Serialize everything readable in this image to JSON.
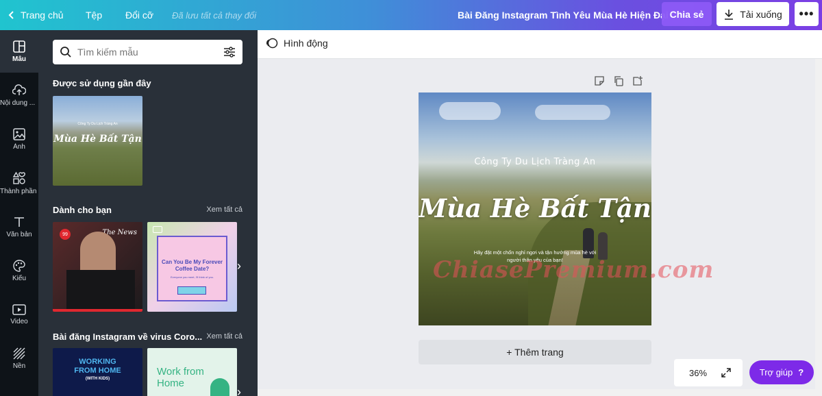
{
  "topbar": {
    "home_label": "Trang chủ",
    "file_label": "Tệp",
    "resize_label": "Đổi cỡ",
    "saved_status": "Đã lưu tất cả thay đổi",
    "doc_title": "Bài Đăng Instagram Tình Yêu Mùa Hè Hiện Đại",
    "share_label": "Chia sẻ",
    "download_label": "Tải xuống",
    "more_label": "•••"
  },
  "rail": {
    "items": [
      {
        "label": "Mẫu",
        "icon": "template-icon"
      },
      {
        "label": "Nội dung ...",
        "icon": "upload-icon"
      },
      {
        "label": "Ảnh",
        "icon": "photo-icon"
      },
      {
        "label": "Thành phần",
        "icon": "elements-icon"
      },
      {
        "label": "Văn bản",
        "icon": "text-icon"
      },
      {
        "label": "Kiểu",
        "icon": "palette-icon"
      },
      {
        "label": "Video",
        "icon": "video-icon"
      },
      {
        "label": "Nền",
        "icon": "background-icon"
      }
    ]
  },
  "panel": {
    "search_placeholder": "Tìm kiếm mẫu",
    "recent_title": "Được sử dụng gần đây",
    "recent_thumb": {
      "company": "Công Ty Du Lịch Tràng An",
      "title": "Mùa Hè Bất Tận"
    },
    "for_you_title": "Dành cho bạn",
    "see_all": "Xem tất cả",
    "for_you_1": {
      "brand": "The News",
      "badge": "99"
    },
    "for_you_2": {
      "title": "Can You Be My Forever Coffee Date?",
      "sub": "Everyone you meet, I'll think of you."
    },
    "virus_title": "Bài đăng Instagram về virus Coro...",
    "virus_1": {
      "line1": "WORKING",
      "line2": "FROM HOME",
      "line3": "(WITH KIDS)"
    },
    "virus_2": {
      "line1": "Work from",
      "line2": "Home"
    }
  },
  "toolbar": {
    "animate_label": "Hình động"
  },
  "design": {
    "company": "Công Ty Du Lịch Tràng An",
    "title": "Mùa Hè Bất Tận",
    "subtitle": "Hãy đặt một chốn nghỉ ngơi và tận hưởng mùa hè với người thân yêu của bạn!"
  },
  "watermark": "ChiasePremium.com",
  "add_page_label": "+ Thêm trang",
  "zoom_label": "36%",
  "help_label": "Trợ giúp",
  "help_icon": "?",
  "colors": {
    "accent": "#7d2ae8",
    "panel_bg": "#293039",
    "rail_bg": "#0e1318",
    "canvas_bg": "#ebecf0"
  }
}
